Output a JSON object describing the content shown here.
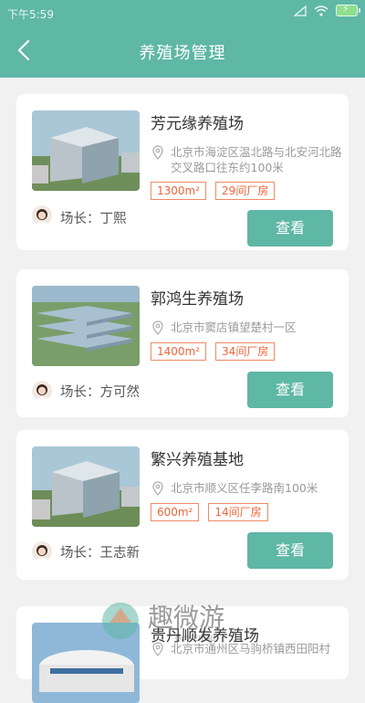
{
  "status_bar": {
    "time": "下午5:59"
  },
  "header": {
    "title": "养殖场管理"
  },
  "farms": [
    {
      "name": "芳元缘养殖场",
      "address": "北京市海淀区温北路与北安河北路交叉路口往东约100米",
      "area": "1300m²",
      "houses": "29间厂房",
      "manager": "场长：丁熙",
      "button": "查看"
    },
    {
      "name": "郭鸿生养殖场",
      "address": "北京市窦店镇望楚村一区",
      "area": "1400m²",
      "houses": "34间厂房",
      "manager": "场长：方可然",
      "button": "查看"
    },
    {
      "name": "繁兴养殖基地",
      "address": "北京市顺义区任李路南100米",
      "area": "600m²",
      "houses": "14间厂房",
      "manager": "场长：王志新",
      "button": "查看"
    },
    {
      "name": "贵丹顺发养殖场",
      "address": "北京市通州区马驹桥镇西田阳村"
    }
  ],
  "watermark": {
    "text": "趣微游",
    "sub": "QUWEIYOU"
  },
  "colors": {
    "primary": "#5fb7a6",
    "tag": "#f0643a"
  }
}
